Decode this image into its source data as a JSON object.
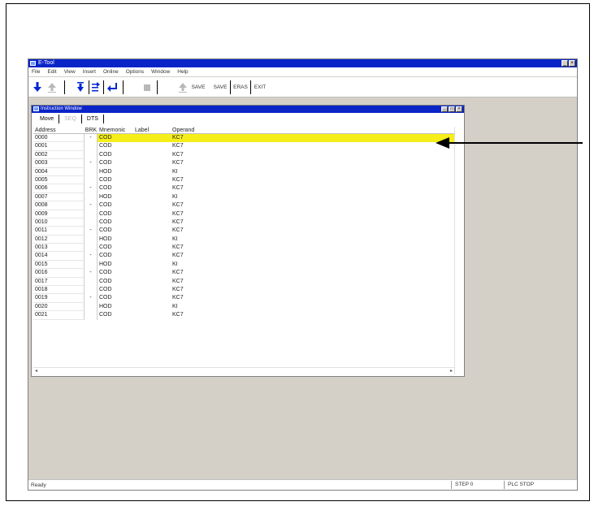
{
  "app": {
    "title": "E-Tool",
    "menu": [
      "File",
      "Edit",
      "View",
      "Insert",
      "Online",
      "Options",
      "Window",
      "Help"
    ]
  },
  "toolbar": {
    "text_buttons": [
      "SAVE",
      "SAVE",
      "ERAS",
      "EXIT"
    ]
  },
  "child": {
    "title": "Instruction Window",
    "tabs": [
      {
        "label": "Move",
        "disabled": false
      },
      {
        "label": "SEQ",
        "disabled": true
      },
      {
        "label": "DTS",
        "disabled": false
      }
    ],
    "columns": [
      "Address",
      "BRK",
      "Mnemonic",
      "Label",
      "Operand"
    ],
    "rows": [
      {
        "address": "0000",
        "brk": "-",
        "mnemonic": "COD",
        "label": "",
        "operand": "KC7",
        "selected": true
      },
      {
        "address": "0001",
        "brk": "",
        "mnemonic": "COD",
        "label": "",
        "operand": "KC7",
        "selected": false
      },
      {
        "address": "0002",
        "brk": "",
        "mnemonic": "COD",
        "label": "",
        "operand": "KC7",
        "selected": false
      },
      {
        "address": "0003",
        "brk": "-",
        "mnemonic": "COD",
        "label": "",
        "operand": "KC7",
        "selected": false
      },
      {
        "address": "0004",
        "brk": "",
        "mnemonic": "HOD",
        "label": "",
        "operand": "KI",
        "selected": false
      },
      {
        "address": "0005",
        "brk": "",
        "mnemonic": "COD",
        "label": "",
        "operand": "KC7",
        "selected": false
      },
      {
        "address": "0006",
        "brk": "-",
        "mnemonic": "COD",
        "label": "",
        "operand": "KC7",
        "selected": false
      },
      {
        "address": "0007",
        "brk": "",
        "mnemonic": "HOD",
        "label": "",
        "operand": "KI",
        "selected": false
      },
      {
        "address": "0008",
        "brk": "-",
        "mnemonic": "COD",
        "label": "",
        "operand": "KC7",
        "selected": false
      },
      {
        "address": "0009",
        "brk": "",
        "mnemonic": "COD",
        "label": "",
        "operand": "KC7",
        "selected": false
      },
      {
        "address": "0010",
        "brk": "",
        "mnemonic": "COD",
        "label": "",
        "operand": "KC7",
        "selected": false
      },
      {
        "address": "0011",
        "brk": "-",
        "mnemonic": "COD",
        "label": "",
        "operand": "KC7",
        "selected": false
      },
      {
        "address": "0012",
        "brk": "",
        "mnemonic": "HOD",
        "label": "",
        "operand": "KI",
        "selected": false
      },
      {
        "address": "0013",
        "brk": "",
        "mnemonic": "COD",
        "label": "",
        "operand": "KC7",
        "selected": false
      },
      {
        "address": "0014",
        "brk": "-",
        "mnemonic": "COD",
        "label": "",
        "operand": "KC7",
        "selected": false
      },
      {
        "address": "0015",
        "brk": "",
        "mnemonic": "HOD",
        "label": "",
        "operand": "KI",
        "selected": false
      },
      {
        "address": "0016",
        "brk": "-",
        "mnemonic": "COD",
        "label": "",
        "operand": "KC7",
        "selected": false
      },
      {
        "address": "0017",
        "brk": "",
        "mnemonic": "COD",
        "label": "",
        "operand": "KC7",
        "selected": false
      },
      {
        "address": "0018",
        "brk": "",
        "mnemonic": "COD",
        "label": "",
        "operand": "KC7",
        "selected": false
      },
      {
        "address": "0019",
        "brk": "-",
        "mnemonic": "COD",
        "label": "",
        "operand": "KC7",
        "selected": false
      },
      {
        "address": "0020",
        "brk": "",
        "mnemonic": "HOD",
        "label": "",
        "operand": "KI",
        "selected": false
      },
      {
        "address": "0021",
        "brk": "",
        "mnemonic": "COD",
        "label": "",
        "operand": "KC7",
        "selected": false
      }
    ]
  },
  "status": {
    "left": "Ready",
    "pane1": "STEP 0",
    "pane2": "PLC STOP"
  },
  "colors": {
    "titlebar": "#0a24c8",
    "selected_row": "#f5ee1a",
    "toolbar_icon": "#0026d0"
  }
}
